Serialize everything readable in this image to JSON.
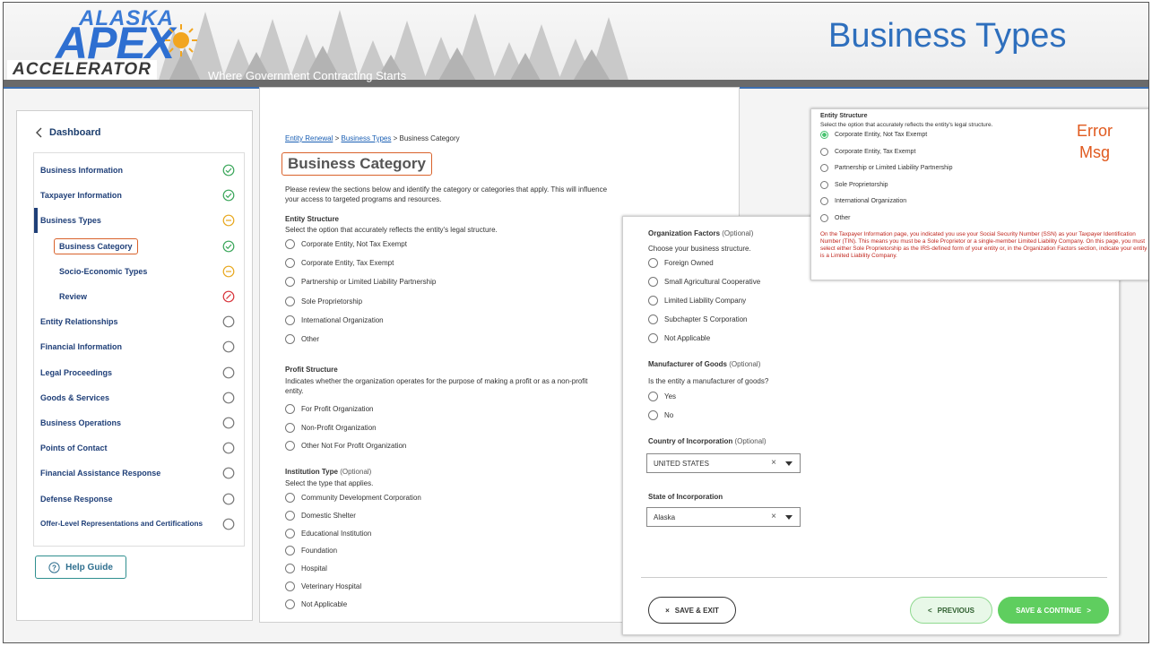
{
  "header": {
    "logo_top": "ALASKA",
    "logo_main": "APEX",
    "logo_bottom": "ACCELERATOR",
    "tagline": "Where Government Contracting Starts",
    "slide_title": "Business Types"
  },
  "colors": {
    "accent": "#2e6fbd",
    "error": "#c0261e",
    "highlight": "#d9622b",
    "success": "#5fce5f"
  },
  "sidebar": {
    "dashboard_label": "Dashboard",
    "items": [
      {
        "label": "Business Information",
        "status": "complete",
        "sub": false
      },
      {
        "label": "Taxpayer Information",
        "status": "complete",
        "sub": false
      },
      {
        "label": "Business Types",
        "status": "in-progress",
        "sub": false,
        "active": true
      },
      {
        "label": "Business Category",
        "status": "complete",
        "sub": true,
        "highlight": true
      },
      {
        "label": "Socio-Economic Types",
        "status": "in-progress",
        "sub": true
      },
      {
        "label": "Review",
        "status": "error",
        "sub": true
      },
      {
        "label": "Entity Relationships",
        "status": "empty",
        "sub": false
      },
      {
        "label": "Financial Information",
        "status": "empty",
        "sub": false
      },
      {
        "label": "Legal Proceedings",
        "status": "empty",
        "sub": false
      },
      {
        "label": "Goods & Services",
        "status": "empty",
        "sub": false
      },
      {
        "label": "Business Operations",
        "status": "empty",
        "sub": false
      },
      {
        "label": "Points of Contact",
        "status": "empty",
        "sub": false
      },
      {
        "label": "Financial Assistance Response",
        "status": "empty",
        "sub": false
      },
      {
        "label": "Defense Response",
        "status": "empty",
        "sub": false
      },
      {
        "label": "Offer-Level Representations and Certifications",
        "status": "empty",
        "sub": false
      }
    ],
    "help_label": "Help Guide"
  },
  "main": {
    "breadcrumb": [
      "Entity Renewal",
      "Business Types",
      "Business Category"
    ],
    "title": "Business Category",
    "intro": "Please review the sections below and identify the category or categories that apply. This will influence your access to targeted programs and resources.",
    "entity_structure": {
      "title": "Entity Structure",
      "desc": "Select the option that accurately reflects the entity's legal structure.",
      "options": [
        "Corporate Entity, Not Tax Exempt",
        "Corporate Entity, Tax Exempt",
        "Partnership or Limited Liability Partnership",
        "Sole Proprietorship",
        "International Organization",
        "Other"
      ]
    },
    "profit_structure": {
      "title": "Profit Structure",
      "desc": "Indicates whether the organization operates for the purpose of making a profit or as a non-profit entity.",
      "options": [
        "For Profit Organization",
        "Non-Profit Organization",
        "Other Not For Profit Organization"
      ]
    },
    "institution_type": {
      "title": "Institution Type",
      "optional": "(Optional)",
      "desc": "Select the type that applies.",
      "options": [
        "Community Development Corporation",
        "Domestic Shelter",
        "Educational Institution",
        "Foundation",
        "Hospital",
        "Veterinary Hospital",
        "Not Applicable"
      ]
    }
  },
  "right": {
    "org_factors": {
      "title": "Organization Factors",
      "optional": "(Optional)",
      "desc": "Choose your business structure.",
      "options": [
        "Foreign Owned",
        "Small Agricultural Cooperative",
        "Limited Liability Company",
        "Subchapter S Corporation",
        "Not Applicable"
      ]
    },
    "manufacturer": {
      "title": "Manufacturer of Goods",
      "optional": "(Optional)",
      "desc": "Is the entity a manufacturer of goods?",
      "options": [
        "Yes",
        "No"
      ]
    },
    "country": {
      "title": "Country of Incorporation",
      "optional": "(Optional)",
      "value": "UNITED STATES"
    },
    "state": {
      "title": "State of Incorporation",
      "value": "Alaska"
    },
    "save_exit": "SAVE & EXIT",
    "previous": "PREVIOUS",
    "save_continue": "SAVE & CONTINUE"
  },
  "error_panel": {
    "title": "Entity Structure",
    "desc": "Select the option that accurately reflects the entity's legal structure.",
    "options": [
      "Corporate Entity, Not Tax Exempt",
      "Corporate Entity, Tax Exempt",
      "Partnership or Limited Liability Partnership",
      "Sole Proprietorship",
      "International Organization",
      "Other"
    ],
    "label_line1": "Error",
    "label_line2": "Msg",
    "message": "On the Taxpayer Information page, you indicated you use your Social Security Number (SSN) as your Taxpayer Identification Number (TIN). This means you must be a Sole Proprietor or a single-member Limited Liability Company. On this page, you must select either Sole Proprietorship as the IRS-defined form of your entity or, in the Organization Factors section, indicate your entity is a Limited Liability Company."
  }
}
